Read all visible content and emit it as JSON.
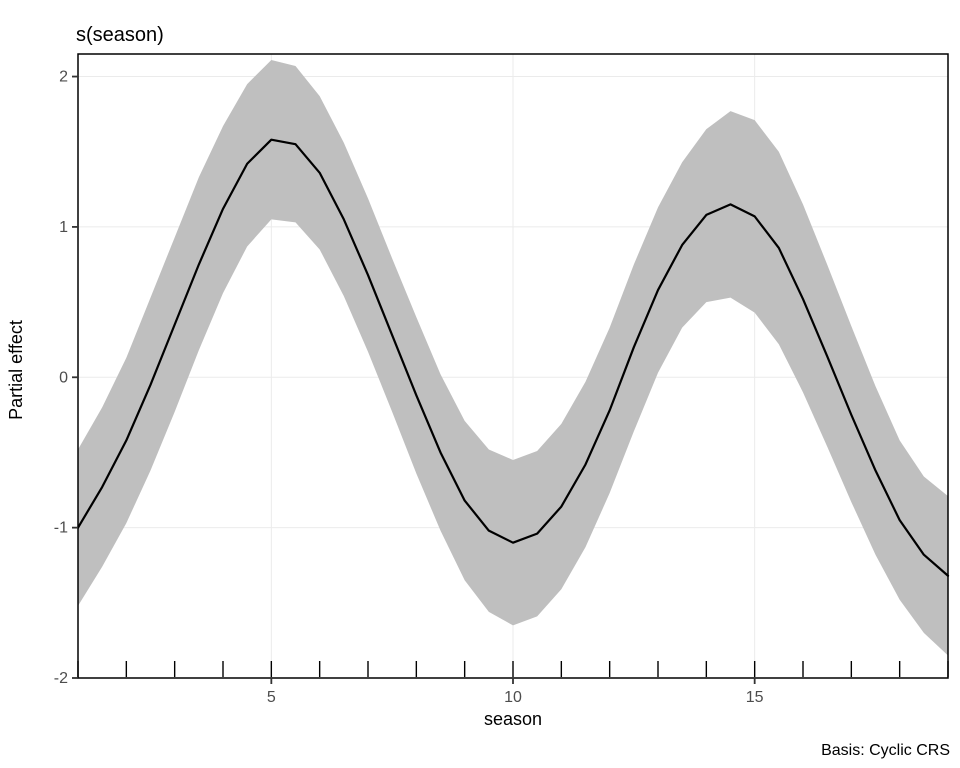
{
  "chart_data": {
    "type": "line",
    "title": "s(season)",
    "xlabel": "season",
    "ylabel": "Partial effect",
    "caption": "Basis: Cyclic CRS",
    "xlim": [
      1,
      19
    ],
    "ylim": [
      -2,
      2.15
    ],
    "x_ticks": [
      5,
      10,
      15
    ],
    "y_ticks": [
      -2,
      -1,
      0,
      1,
      2
    ],
    "rug_x": [
      1,
      2,
      3,
      4,
      5,
      6,
      7,
      8,
      9,
      10,
      11,
      12,
      13,
      14,
      15,
      16,
      17,
      18,
      19
    ],
    "series": [
      {
        "name": "fit",
        "x": [
          1.0,
          1.5,
          2.0,
          2.5,
          3.0,
          3.5,
          4.0,
          4.5,
          5.0,
          5.5,
          6.0,
          6.5,
          7.0,
          7.5,
          8.0,
          8.5,
          9.0,
          9.5,
          10.0,
          10.5,
          11.0,
          11.5,
          12.0,
          12.5,
          13.0,
          13.5,
          14.0,
          14.5,
          15.0,
          15.5,
          16.0,
          16.5,
          17.0,
          17.5,
          18.0,
          18.5,
          19.0
        ],
        "y": [
          -1.0,
          -0.73,
          -0.42,
          -0.05,
          0.35,
          0.75,
          1.12,
          1.42,
          1.58,
          1.55,
          1.36,
          1.05,
          0.68,
          0.28,
          -0.12,
          -0.5,
          -0.82,
          -1.02,
          -1.1,
          -1.04,
          -0.86,
          -0.58,
          -0.22,
          0.2,
          0.58,
          0.88,
          1.08,
          1.15,
          1.07,
          0.86,
          0.52,
          0.14,
          -0.25,
          -0.62,
          -0.95,
          -1.18,
          -1.32
        ],
        "lo": [
          -1.52,
          -1.26,
          -0.97,
          -0.62,
          -0.23,
          0.18,
          0.56,
          0.87,
          1.05,
          1.03,
          0.85,
          0.54,
          0.17,
          -0.23,
          -0.64,
          -1.02,
          -1.35,
          -1.56,
          -1.65,
          -1.59,
          -1.41,
          -1.13,
          -0.77,
          -0.36,
          0.03,
          0.33,
          0.5,
          0.53,
          0.43,
          0.22,
          -0.1,
          -0.46,
          -0.83,
          -1.18,
          -1.48,
          -1.7,
          -1.85
        ],
        "hi": [
          -0.48,
          -0.2,
          0.13,
          0.53,
          0.93,
          1.33,
          1.67,
          1.95,
          2.11,
          2.07,
          1.87,
          1.56,
          1.19,
          0.79,
          0.4,
          0.02,
          -0.29,
          -0.48,
          -0.55,
          -0.49,
          -0.31,
          -0.03,
          0.33,
          0.75,
          1.13,
          1.43,
          1.65,
          1.77,
          1.71,
          1.5,
          1.15,
          0.75,
          0.34,
          -0.06,
          -0.42,
          -0.66,
          -0.79
        ]
      }
    ]
  },
  "labels": {
    "title": "s(season)",
    "xlabel": "season",
    "ylabel": "Partial effect",
    "caption": "Basis: Cyclic CRS"
  },
  "ticks": {
    "x": {
      "5": "5",
      "10": "10",
      "15": "15"
    },
    "y": {
      "-2": "-2",
      "-1": "-1",
      "0": "0",
      "1": "1",
      "2": "2"
    }
  }
}
